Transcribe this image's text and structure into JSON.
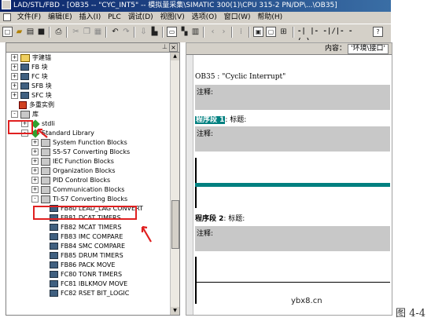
{
  "window": {
    "title": "LAD/STL/FBD - [OB35 -- \"CYC_INT5\" -- 模拟量采集\\SIMATIC 300(1)\\CPU 315-2 PN/DP\\...\\OB35]"
  },
  "menu": {
    "items": [
      "文件(F)",
      "编辑(E)",
      "插入(I)",
      "PLC",
      "调试(D)",
      "视图(V)",
      "选项(O)",
      "窗口(W)",
      "帮助(H)"
    ]
  },
  "toolbar": {
    "icons": [
      "new-icon",
      "open-icon",
      "catalog-icon",
      "save-icon",
      "print-icon",
      "cut-icon",
      "copy-icon",
      "paste-icon",
      "undo-icon",
      "redo-icon",
      "download-icon",
      "monitor-icon",
      "overview-icon",
      "network-icon",
      "compile-icon",
      "help-icon",
      "window-icon",
      "split-icon",
      "layout-icon",
      "contact-icon",
      "no-contact-icon",
      "coil-icon",
      "box-icon"
    ],
    "contact_glyphs": "-| |- -|/|- -( )"
  },
  "tree": {
    "nodes": [
      {
        "label": "宇建锚",
        "depth": 0,
        "sign": "+",
        "icon": "folder"
      },
      {
        "label": "FB 块",
        "depth": 0,
        "sign": "+",
        "icon": "blk"
      },
      {
        "label": "FC 块",
        "depth": 0,
        "sign": "+",
        "icon": "blk"
      },
      {
        "label": "SFB 块",
        "depth": 0,
        "sign": "+",
        "icon": "blk"
      },
      {
        "label": "SFC 块",
        "depth": 0,
        "sign": "+",
        "icon": "blk"
      },
      {
        "label": "多重实例",
        "depth": 0,
        "sign": "",
        "icon": "proj"
      },
      {
        "label": "库",
        "depth": 0,
        "sign": "-",
        "icon": "lib"
      },
      {
        "label": "stdli",
        "depth": 1,
        "sign": "+",
        "icon": "diamond"
      },
      {
        "label": "Standard Library",
        "depth": 1,
        "sign": "-",
        "icon": "diamond"
      },
      {
        "label": "System Function Blocks",
        "depth": 2,
        "sign": "+",
        "icon": "lib"
      },
      {
        "label": "S5-S7 Converting Blocks",
        "depth": 2,
        "sign": "+",
        "icon": "lib"
      },
      {
        "label": "IEC Function Blocks",
        "depth": 2,
        "sign": "+",
        "icon": "lib"
      },
      {
        "label": "Organization Blocks",
        "depth": 2,
        "sign": "+",
        "icon": "lib"
      },
      {
        "label": "PID Control Blocks",
        "depth": 2,
        "sign": "+",
        "icon": "lib"
      },
      {
        "label": "Communication Blocks",
        "depth": 2,
        "sign": "+",
        "icon": "lib"
      },
      {
        "label": "TI-S7 Converting Blocks",
        "depth": 2,
        "sign": "-",
        "icon": "lib"
      },
      {
        "label": "FB80  LEAD_LAG  CONVERT",
        "depth": 3,
        "sign": "",
        "icon": "blk"
      },
      {
        "label": "FB81  DCAT  TIMERS",
        "depth": 3,
        "sign": "",
        "icon": "blk"
      },
      {
        "label": "FB82  MCAT  TIMERS",
        "depth": 3,
        "sign": "",
        "icon": "blk"
      },
      {
        "label": "FB83  IMC  COMPARE",
        "depth": 3,
        "sign": "",
        "icon": "blk"
      },
      {
        "label": "FB84  SMC  COMPARE",
        "depth": 3,
        "sign": "",
        "icon": "blk"
      },
      {
        "label": "FB85  DRUM  TIMERS",
        "depth": 3,
        "sign": "",
        "icon": "blk"
      },
      {
        "label": "FB86  PACK  MOVE",
        "depth": 3,
        "sign": "",
        "icon": "blk"
      },
      {
        "label": "FC80  TONR  TIMERS",
        "depth": 3,
        "sign": "",
        "icon": "blk"
      },
      {
        "label": "FC81  IBLKMOV  MOVE",
        "depth": 3,
        "sign": "",
        "icon": "blk"
      },
      {
        "label": "FC82  RSET  BIT_LOGIC",
        "depth": 3,
        "sign": "",
        "icon": "blk"
      }
    ]
  },
  "editor": {
    "content_label": "内容：",
    "content_value": "'环境\\接口'",
    "ob_title": "OB35 :  \"Cyclic Interrupt\"",
    "comment_label": "注释:",
    "network1_label": "程序段 1",
    "network1_title": ": 标题:",
    "network2_label": "程序段 2",
    "network2_title": ": 标题:"
  },
  "page": {
    "watermark": "ybx8.cn",
    "figure_label": "图 4-4"
  },
  "colors": {
    "title_bar": "#0a246a",
    "chrome": "#d4d0c8",
    "comment_bg": "#c8c8c8",
    "rung": "#008080",
    "highlight": "#e02020"
  }
}
